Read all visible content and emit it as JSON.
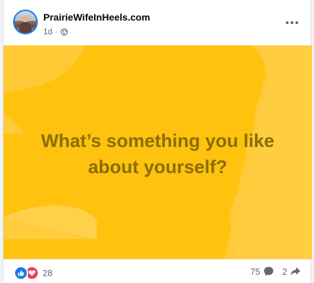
{
  "post": {
    "page_name": "PrairieWifeInHeels.com",
    "time_ago": "1d",
    "separator": "·",
    "audience_icon": "globe-icon",
    "menu_icon": "more-options-icon",
    "text_lines": [
      "What’s something you like",
      "about yourself?"
    ],
    "background_color": "#ffc20e",
    "text_color": "#8a6d07"
  },
  "footer": {
    "reactions": [
      "like-icon",
      "love-icon"
    ],
    "reaction_count": "28",
    "comment_count": "75",
    "comment_icon": "comment-bubble-icon",
    "share_count": "2",
    "share_icon": "share-arrow-icon"
  }
}
